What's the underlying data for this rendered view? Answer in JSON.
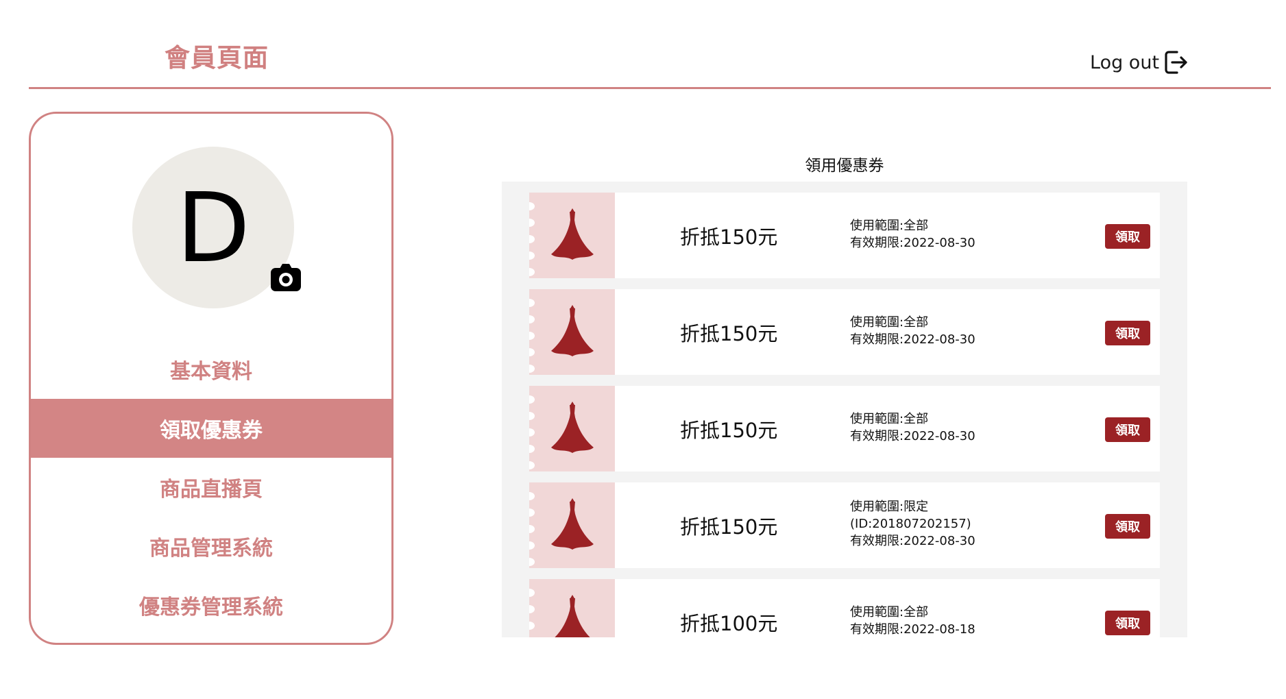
{
  "header": {
    "title": "會員頁面",
    "logout_label": "Log out"
  },
  "profile": {
    "avatar_letter": "D"
  },
  "sidebar": {
    "items": [
      {
        "label": "基本資料",
        "active": false
      },
      {
        "label": "領取優惠券",
        "active": true
      },
      {
        "label": "商品直播頁",
        "active": false
      },
      {
        "label": "商品管理系統",
        "active": false
      },
      {
        "label": "優惠券管理系統",
        "active": false
      }
    ]
  },
  "main": {
    "title": "領用優惠券",
    "coupons": [
      {
        "amount": "折抵150元",
        "scope": "使用範圍:全部",
        "scope_extra": "",
        "expiry": "有效期限:2022-08-30",
        "button": "領取"
      },
      {
        "amount": "折抵150元",
        "scope": "使用範圍:全部",
        "scope_extra": "",
        "expiry": "有效期限:2022-08-30",
        "button": "領取"
      },
      {
        "amount": "折抵150元",
        "scope": "使用範圍:全部",
        "scope_extra": "",
        "expiry": "有效期限:2022-08-30",
        "button": "領取"
      },
      {
        "amount": "折抵150元",
        "scope": "使用範圍:限定",
        "scope_extra": "(ID:201807202157)",
        "expiry": "有效期限:2022-08-30",
        "button": "領取"
      },
      {
        "amount": "折抵100元",
        "scope": "使用範圍:全部",
        "scope_extra": "",
        "expiry": "有效期限:2022-08-18",
        "button": "領取"
      }
    ]
  },
  "colors": {
    "accent": "#d08282",
    "active_nav": "#d38585",
    "button": "#9b2225",
    "coupon_stub": "#f1d7d7",
    "panel_bg": "#f3f3f3",
    "avatar_bg": "#edebe6"
  },
  "icons": {
    "logout": "logout-icon",
    "camera": "camera-icon",
    "dress": "dress-icon"
  }
}
